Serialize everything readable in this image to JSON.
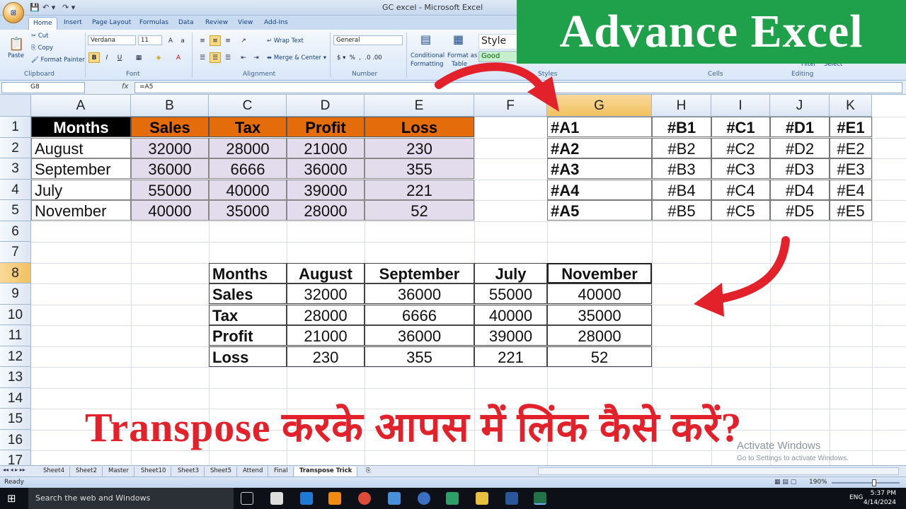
{
  "window": {
    "title": "GC excel - Microsoft Excel"
  },
  "ribbon_tabs": [
    "Home",
    "Insert",
    "Page Layout",
    "Formulas",
    "Data",
    "Review",
    "View",
    "Add-Ins"
  ],
  "ribbon": {
    "clipboard": {
      "paste": "Paste",
      "cut": "Cut",
      "copy": "Copy",
      "format_painter": "Format Painter",
      "label": "Clipboard"
    },
    "font": {
      "name": "Verdana",
      "size": "11",
      "label": "Font"
    },
    "alignment": {
      "wrap": "Wrap Text",
      "merge": "Merge & Center",
      "label": "Alignment"
    },
    "number": {
      "format": "General",
      "label": "Number"
    },
    "styles": {
      "cond": "Conditional",
      "cond2": "Formatting",
      "fmt_table": "Format as",
      "fmt_table2": "Table",
      "style_label": "Style",
      "good": "Good",
      "label": "Styles"
    },
    "cells": {
      "label": "Cells"
    },
    "editing": {
      "filter": "Filter",
      "select": "Select",
      "label": "Editing"
    }
  },
  "formula_bar": {
    "name_box": "G8",
    "fx": "fx",
    "formula": "=A5"
  },
  "columns": [
    "A",
    "B",
    "C",
    "D",
    "E",
    "F",
    "G",
    "H",
    "I",
    "J",
    "K"
  ],
  "rows": [
    "1",
    "2",
    "3",
    "4",
    "5",
    "6",
    "7",
    "8",
    "9",
    "10",
    "11",
    "12",
    "13",
    "14",
    "15",
    "16",
    "17"
  ],
  "source_table": {
    "headers": [
      "Months",
      "Sales",
      "Tax",
      "Profit",
      "Loss"
    ],
    "rows": [
      [
        "August",
        "32000",
        "28000",
        "21000",
        "230"
      ],
      [
        "September",
        "36000",
        "6666",
        "36000",
        "355"
      ],
      [
        "July",
        "55000",
        "40000",
        "39000",
        "221"
      ],
      [
        "November",
        "40000",
        "35000",
        "28000",
        "52"
      ]
    ]
  },
  "ref_table": {
    "rows": [
      [
        "#A1",
        "#B1",
        "#C1",
        "#D1",
        "#E1"
      ],
      [
        "#A2",
        "#B2",
        "#C2",
        "#D2",
        "#E2"
      ],
      [
        "#A3",
        "#B3",
        "#C3",
        "#D3",
        "#E3"
      ],
      [
        "#A4",
        "#B4",
        "#C4",
        "#D4",
        "#E4"
      ],
      [
        "#A5",
        "#B5",
        "#C5",
        "#D5",
        "#E5"
      ]
    ]
  },
  "transposed_table": {
    "rows": [
      [
        "Months",
        "August",
        "September",
        "July",
        "November"
      ],
      [
        "Sales",
        "32000",
        "36000",
        "55000",
        "40000"
      ],
      [
        "Tax",
        "28000",
        "6666",
        "40000",
        "35000"
      ],
      [
        "Profit",
        "21000",
        "36000",
        "39000",
        "28000"
      ],
      [
        "Loss",
        "230",
        "355",
        "221",
        "52"
      ]
    ]
  },
  "sheet_tabs": [
    "Sheet4",
    "Sheet2",
    "Master",
    "Sheet10",
    "Sheet3",
    "Sheet5",
    "Attend",
    "Final",
    "Transpose Trick"
  ],
  "active_sheet": "Transpose Trick",
  "status": {
    "ready": "Ready",
    "zoom": "190%"
  },
  "overlay": {
    "banner": "Advance Excel",
    "caption": "Transpose करके आपस में लिंक कैसे करें?",
    "watermark_title": "Activate Windows",
    "watermark_sub": "Go to Settings to activate Windows."
  },
  "taskbar": {
    "search": "Search the web and Windows",
    "lang": "ENG",
    "time": "5:37 PM",
    "date": "4/14/2024"
  },
  "colors": {
    "header_orange": "#e46c0a",
    "header_black": "#000000",
    "data_fill": "#e3dcec",
    "banner_green": "#1ea14a",
    "caption_red": "#e2212b"
  }
}
